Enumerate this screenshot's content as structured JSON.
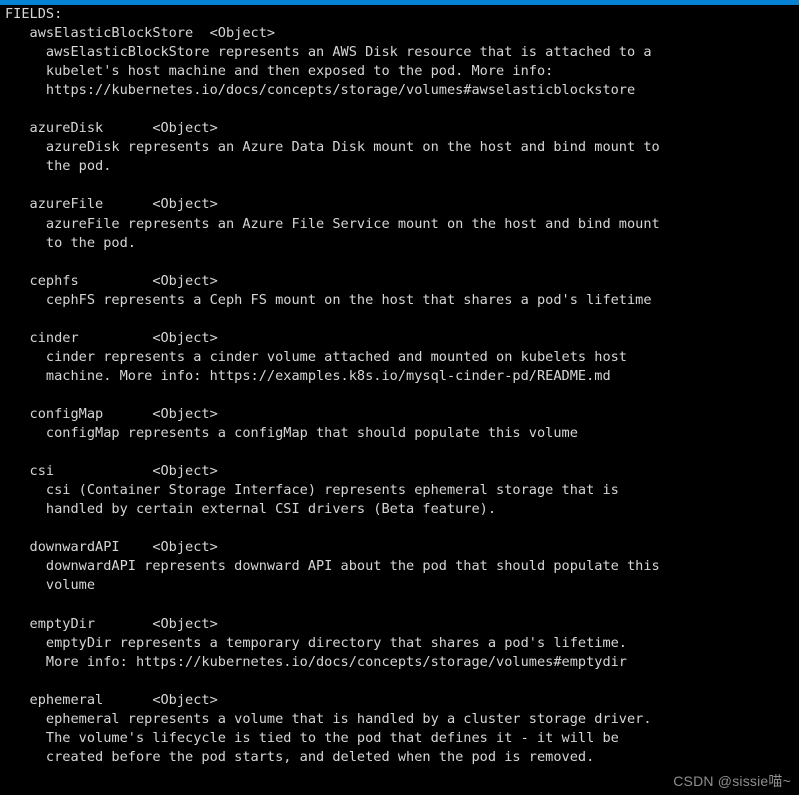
{
  "terminal": {
    "background_color": "#000000",
    "text_color": "#d6d6d6",
    "accent_bar_color": "#0682d4",
    "header": "FIELDS:",
    "lines": [
      "FIELDS:",
      "   awsElasticBlockStore\t<Object>",
      "     awsElasticBlockStore represents an AWS Disk resource that is attached to a",
      "     kubelet's host machine and then exposed to the pod. More info:",
      "     https://kubernetes.io/docs/concepts/storage/volumes#awselasticblockstore",
      "",
      "   azureDisk\t<Object>",
      "     azureDisk represents an Azure Data Disk mount on the host and bind mount to",
      "     the pod.",
      "",
      "   azureFile\t<Object>",
      "     azureFile represents an Azure File Service mount on the host and bind mount",
      "     to the pod.",
      "",
      "   cephfs\t<Object>",
      "     cephFS represents a Ceph FS mount on the host that shares a pod's lifetime",
      "",
      "   cinder\t<Object>",
      "     cinder represents a cinder volume attached and mounted on kubelets host",
      "     machine. More info: https://examples.k8s.io/mysql-cinder-pd/README.md",
      "",
      "   configMap\t<Object>",
      "     configMap represents a configMap that should populate this volume",
      "",
      "   csi\t<Object>",
      "     csi (Container Storage Interface) represents ephemeral storage that is",
      "     handled by certain external CSI drivers (Beta feature).",
      "",
      "   downwardAPI\t<Object>",
      "     downwardAPI represents downward API about the pod that should populate this",
      "     volume",
      "",
      "   emptyDir\t<Object>",
      "     emptyDir represents a temporary directory that shares a pod's lifetime.",
      "     More info: https://kubernetes.io/docs/concepts/storage/volumes#emptydir",
      "",
      "   ephemeral\t<Object>",
      "     ephemeral represents a volume that is handled by a cluster storage driver.",
      "     The volume's lifecycle is tied to the pod that defines it - it will be",
      "     created before the pod starts, and deleted when the pod is removed."
    ],
    "fields": [
      {
        "name": "awsElasticBlockStore",
        "type": "<Object>",
        "description": [
          "awsElasticBlockStore represents an AWS Disk resource that is attached to a",
          "kubelet's host machine and then exposed to the pod. More info:",
          "https://kubernetes.io/docs/concepts/storage/volumes#awselasticblockstore"
        ]
      },
      {
        "name": "azureDisk",
        "type": "<Object>",
        "description": [
          "azureDisk represents an Azure Data Disk mount on the host and bind mount to",
          "the pod."
        ]
      },
      {
        "name": "azureFile",
        "type": "<Object>",
        "description": [
          "azureFile represents an Azure File Service mount on the host and bind mount",
          "to the pod."
        ]
      },
      {
        "name": "cephfs",
        "type": "<Object>",
        "description": [
          "cephFS represents a Ceph FS mount on the host that shares a pod's lifetime"
        ]
      },
      {
        "name": "cinder",
        "type": "<Object>",
        "description": [
          "cinder represents a cinder volume attached and mounted on kubelets host",
          "machine. More info: https://examples.k8s.io/mysql-cinder-pd/README.md"
        ]
      },
      {
        "name": "configMap",
        "type": "<Object>",
        "description": [
          "configMap represents a configMap that should populate this volume"
        ]
      },
      {
        "name": "csi",
        "type": "<Object>",
        "description": [
          "csi (Container Storage Interface) represents ephemeral storage that is",
          "handled by certain external CSI drivers (Beta feature)."
        ]
      },
      {
        "name": "downwardAPI",
        "type": "<Object>",
        "description": [
          "downwardAPI represents downward API about the pod that should populate this",
          "volume"
        ]
      },
      {
        "name": "emptyDir",
        "type": "<Object>",
        "description": [
          "emptyDir represents a temporary directory that shares a pod's lifetime.",
          "More info: https://kubernetes.io/docs/concepts/storage/volumes#emptydir"
        ]
      },
      {
        "name": "ephemeral",
        "type": "<Object>",
        "description": [
          "ephemeral represents a volume that is handled by a cluster storage driver.",
          "The volume's lifecycle is tied to the pod that defines it - it will be",
          "created before the pod starts, and deleted when the pod is removed."
        ]
      }
    ]
  },
  "watermark": {
    "text": "CSDN @sissie喵~",
    "color": "#8e8e8e"
  }
}
